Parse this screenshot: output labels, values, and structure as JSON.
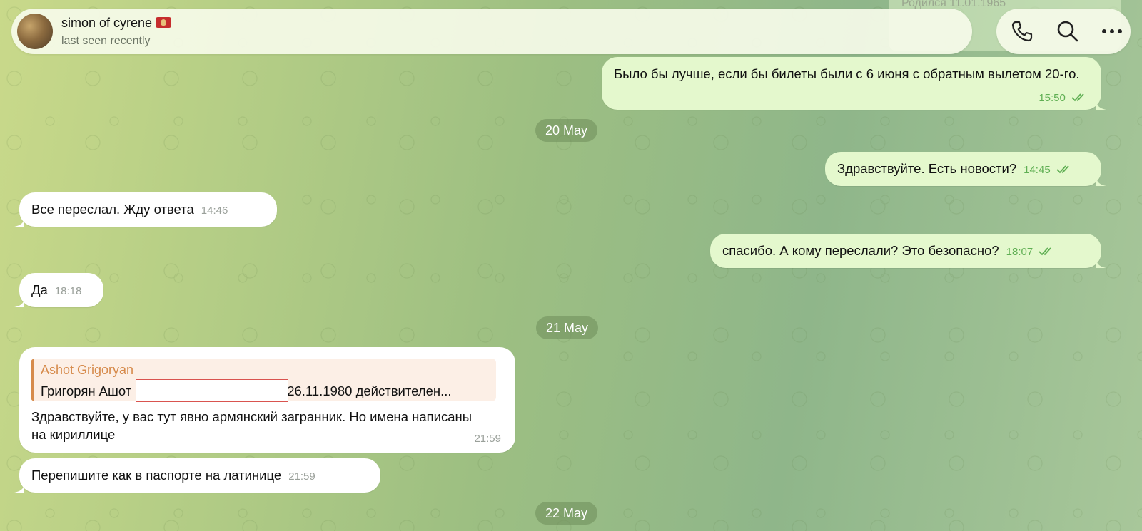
{
  "chat": {
    "name": "simon of cyrene",
    "status": "last seen recently"
  },
  "background_note": {
    "text": "Родился 11.01.1965"
  },
  "messages": {
    "m1": {
      "text": "Было бы лучше, если бы билеты были с 6 июня с обратным вылетом 20-го.",
      "time": "15:50"
    },
    "d1": "20 May",
    "m2": {
      "text": "Здравствуйте. Есть новости?",
      "time": "14:45"
    },
    "m3": {
      "text": "Все переслал. Жду ответа",
      "time": "14:46"
    },
    "m4": {
      "text": "спасибо. А кому переслали? Это безопасно?",
      "time": "18:07"
    },
    "m5": {
      "text": "Да",
      "time": "18:18"
    },
    "d2": "21 May",
    "m6": {
      "reply_name": "Ashot Grigoryan",
      "reply_prefix": "Григорян Ашот",
      "reply_suffix": "26.11.1980 действителен...",
      "text": "Здравствуйте, у вас тут явно армянский загранник. Но имена написаны на кириллице",
      "time": "21:59"
    },
    "m7": {
      "text": "Перепишите как в паспорте на латинице",
      "time": "21:59"
    },
    "d3": "22 May"
  },
  "colors": {
    "incoming": "#ffffff",
    "outgoing": "#e4f8cd",
    "read_ticks": "#5faf53",
    "reply_accent": "#d68b4c"
  },
  "icons": [
    "phone-icon",
    "search-icon",
    "more-icon",
    "double-check-icon"
  ]
}
